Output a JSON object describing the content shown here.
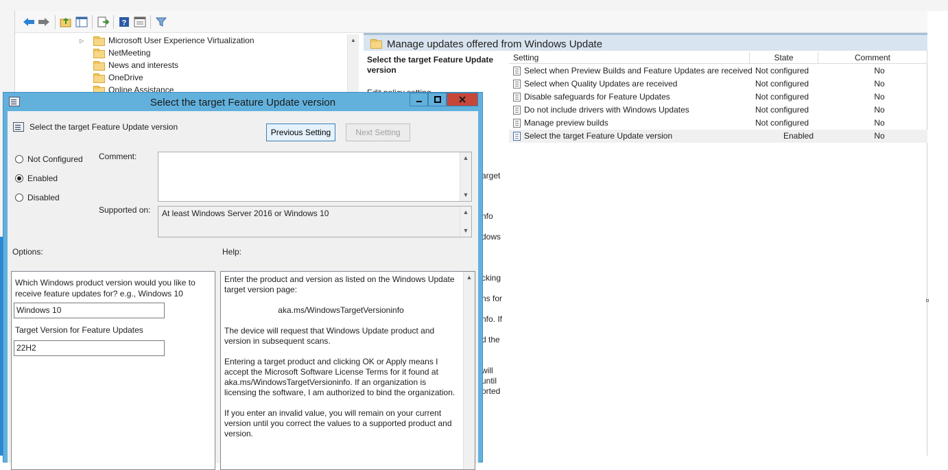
{
  "console": {
    "tree": [
      {
        "label": "Microsoft User Experience Virtualization",
        "expandable": true
      },
      {
        "label": "NetMeeting",
        "expandable": false
      },
      {
        "label": "News and interests",
        "expandable": false
      },
      {
        "label": "OneDrive",
        "expandable": false
      },
      {
        "label": "Online Assistance",
        "expandable": false
      }
    ],
    "right_header": "Manage updates offered from Windows Update",
    "desc_title": "Select the target Feature Update version",
    "desc_fragments": [
      "Edit policy setting",
      "arget",
      "nfo",
      "dows",
      "cking",
      "ns for",
      "nfo. If",
      "d the",
      "will",
      "until",
      "orted"
    ],
    "columns": {
      "setting": "Setting",
      "state": "State",
      "comment": "Comment"
    },
    "rows": [
      {
        "name": "Select when Preview Builds and Feature Updates are received",
        "state": "Not configured",
        "comment": "No"
      },
      {
        "name": "Select when Quality Updates are received",
        "state": "Not configured",
        "comment": "No"
      },
      {
        "name": "Disable safeguards for Feature Updates",
        "state": "Not configured",
        "comment": "No"
      },
      {
        "name": "Do not include drivers with Windows Updates",
        "state": "Not configured",
        "comment": "No"
      },
      {
        "name": "Manage preview builds",
        "state": "Not configured",
        "comment": "No"
      },
      {
        "name": "Select the target Feature Update version",
        "state": "Enabled",
        "comment": "No"
      }
    ]
  },
  "dialog": {
    "title": "Select the target Feature Update version",
    "subtitle": "Select the target Feature Update version",
    "prev_button": "Previous Setting",
    "next_button": "Next Setting",
    "radios": {
      "not_configured": "Not Configured",
      "enabled": "Enabled",
      "disabled": "Disabled"
    },
    "selected_radio": "Enabled",
    "comment_label": "Comment:",
    "comment_value": "",
    "supported_label": "Supported on:",
    "supported_value": "At least Windows Server 2016 or Windows 10",
    "options_label": "Options:",
    "help_label": "Help:",
    "options": {
      "question": "Which Windows product version would you like to receive feature updates for? e.g., Windows 10",
      "product_value": "Windows 10",
      "target_label": "Target Version for Feature Updates",
      "target_value": "22H2"
    },
    "help": {
      "p1": "Enter the product and version as listed on the Windows Update target version page:",
      "p2": "aka.ms/WindowsTargetVersioninfo",
      "p3": "The device will request that Windows Update product and version in subsequent scans.",
      "p4": "Entering a target product and clicking OK or Apply means I accept the Microsoft Software License Terms for it found at aka.ms/WindowsTargetVersioninfo. If an organization is licensing the software, I am authorized to bind the organization.",
      "p5": "If you enter an invalid value, you will remain on your current version until you correct the values to a supported product and version."
    }
  },
  "colors": {
    "titlebar": "#62b1dd",
    "close": "#c7463a",
    "header": "#d8e4ef"
  }
}
